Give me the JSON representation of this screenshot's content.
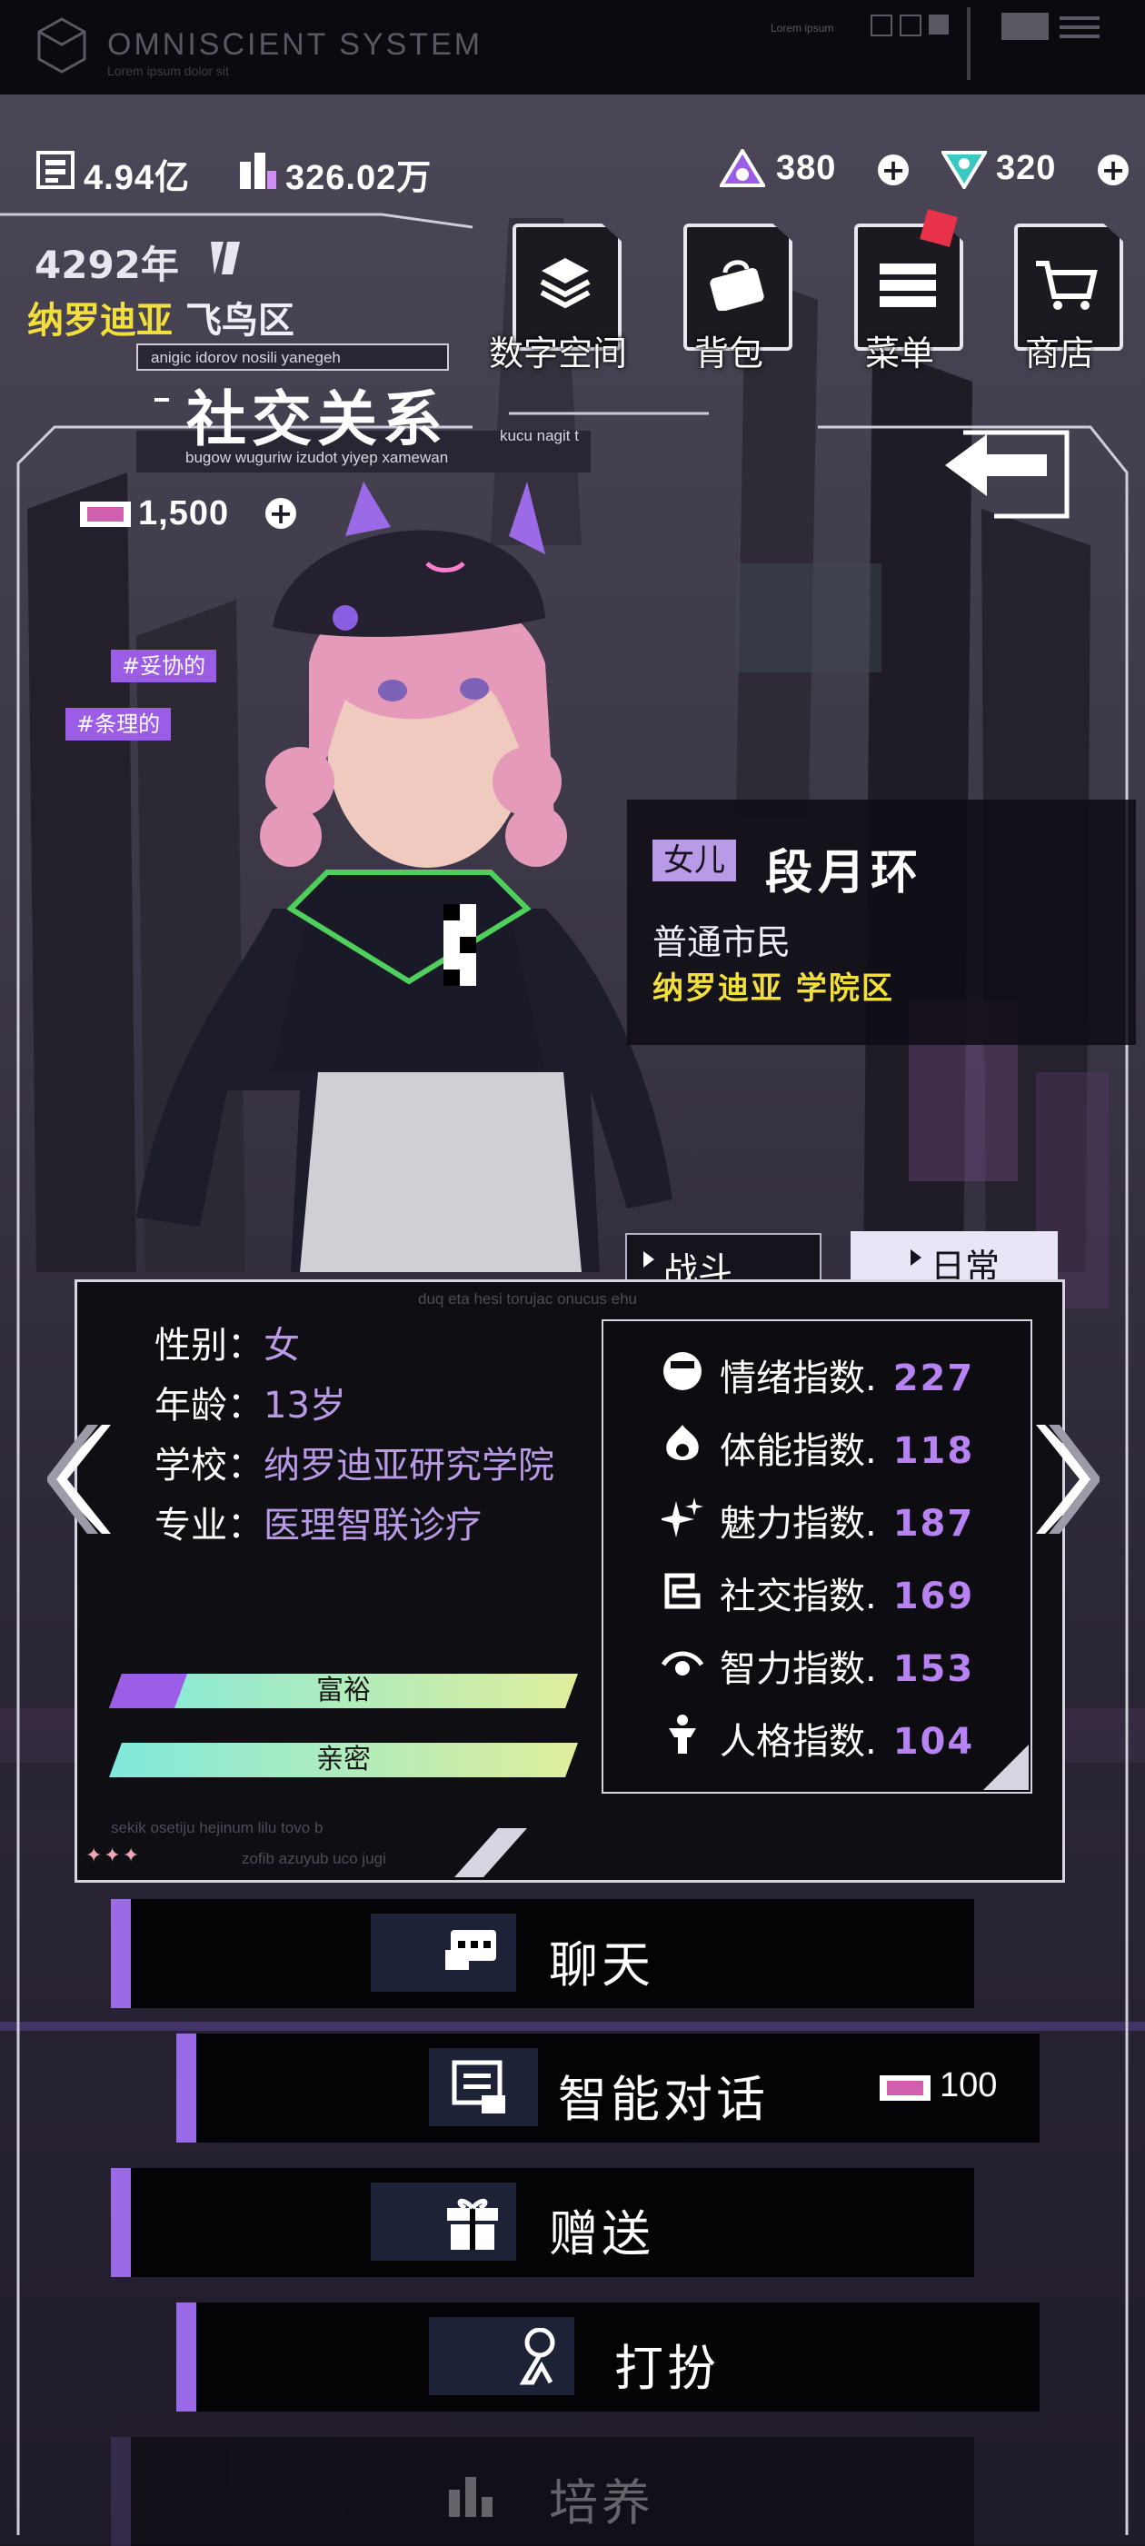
{
  "system_bar": {
    "title": "OMNISCIENT SYSTEM",
    "subtitle": "Lorem ipsum dolor sit",
    "lorem": "Lorem ipsum"
  },
  "currency": {
    "money": "4.94亿",
    "fans": "326.02万",
    "gem_a": "380",
    "gem_b": "320",
    "token": "1,500"
  },
  "date": {
    "year": "4292年"
  },
  "location": {
    "city": "纳罗迪亚",
    "district": "飞鸟区"
  },
  "top_menu": [
    {
      "label": "数字空间",
      "icon": "layers-icon"
    },
    {
      "label": "背包",
      "icon": "bag-icon"
    },
    {
      "label": "菜单",
      "icon": "list-icon"
    },
    {
      "label": "商店",
      "icon": "cart-icon"
    }
  ],
  "section": {
    "title": "社交关系",
    "small_top": "anigic idorov nosili yanegeh",
    "small_bottom": "bugow wuguriw izudot yiyep xamewan",
    "small_right": "kucu nagit t"
  },
  "tags": [
    "#妥协的",
    "#条理的"
  ],
  "character": {
    "relation": "女儿",
    "name": "段月环",
    "role": "普通市民",
    "location": "纳罗迪亚 学院区"
  },
  "tabs": {
    "battle": "战斗",
    "daily": "日常"
  },
  "panel_texts": {
    "top": "duq eta hesi torujac onucus ehu",
    "bottom_a": "sekik osetiju hejinum lilu tovo b",
    "bottom_b": "zofib azuyub uco jugi"
  },
  "info": [
    {
      "key": "性别：",
      "value": "女"
    },
    {
      "key": "年龄：",
      "value": "13岁"
    },
    {
      "key": "学校：",
      "value": "纳罗迪亚研究学院"
    },
    {
      "key": "专业：",
      "value": "医理智联诊疗"
    }
  ],
  "bars": [
    {
      "label": "富裕",
      "fill": 0.15
    },
    {
      "label": "亲密",
      "fill": 0.0
    }
  ],
  "stats": [
    {
      "label": "情绪指数.",
      "value": "227",
      "icon": "mood-icon"
    },
    {
      "label": "体能指数.",
      "value": "118",
      "icon": "strength-icon"
    },
    {
      "label": "魅力指数.",
      "value": "187",
      "icon": "sparkle-icon"
    },
    {
      "label": "社交指数.",
      "value": "169",
      "icon": "social-icon"
    },
    {
      "label": "智力指数.",
      "value": "153",
      "icon": "eye-icon"
    },
    {
      "label": "人格指数.",
      "value": "104",
      "icon": "person-icon"
    }
  ],
  "actions": {
    "chat": "聊天",
    "smart_chat": "智能对话",
    "smart_chat_cost": "100",
    "gift": "赠送",
    "dress": "打扮",
    "train": "培养"
  },
  "colors": {
    "accent": "#9b5ce6",
    "stat_value": "#b783f2",
    "location": "#f2df3c"
  }
}
